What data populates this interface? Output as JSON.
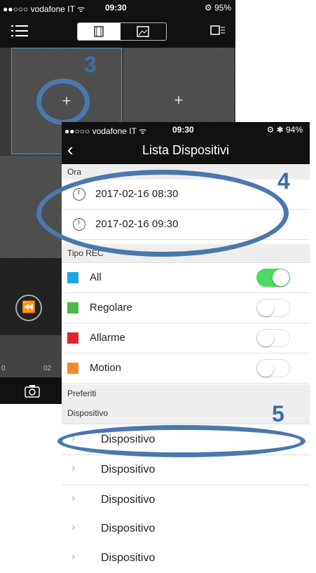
{
  "back": {
    "status": {
      "carrier": "●●○○○ vodafone IT ᯤ",
      "time": "09:30",
      "battery": "⚙ 95%"
    },
    "cells": [
      "+",
      "+"
    ],
    "timeline_ticks": [
      "0",
      "02"
    ],
    "step_label": "3"
  },
  "front": {
    "status": {
      "carrier": "●●○○○ vodafone IT ᯤ",
      "time": "09:30",
      "battery": "⚙ ✱ 94%"
    },
    "title": "Lista Dispositivi",
    "sections": {
      "time": "Ora",
      "rec_type": "Tipo REC",
      "favorites": "Preferiti",
      "device": "Dispositivo"
    },
    "times": [
      "2017-02-16 08:30",
      "2017-02-16 09:30"
    ],
    "rec_types": [
      {
        "label": "All",
        "color": "#1aa6e6",
        "on": true
      },
      {
        "label": "Regolare",
        "color": "#4cb848",
        "on": false
      },
      {
        "label": "Allarme",
        "color": "#e0242c",
        "on": false
      },
      {
        "label": "Motion",
        "color": "#f58a2a",
        "on": false
      }
    ],
    "devices": [
      "Dispositivo",
      "Dispositivo",
      "Dispositivo",
      "Dispositivo",
      "Dispositivo"
    ],
    "step_labels": [
      "4",
      "5"
    ]
  },
  "colors": {
    "annotation": "#4a78ae",
    "toggle_on": "#4cd964"
  },
  "icons": {
    "menu": "menu-icon",
    "video": "video-icon",
    "image": "image-icon",
    "camera": "camera-icon",
    "rewind": "rewind-icon",
    "clock": "clock-icon",
    "chevron": "chevron-right-icon"
  }
}
